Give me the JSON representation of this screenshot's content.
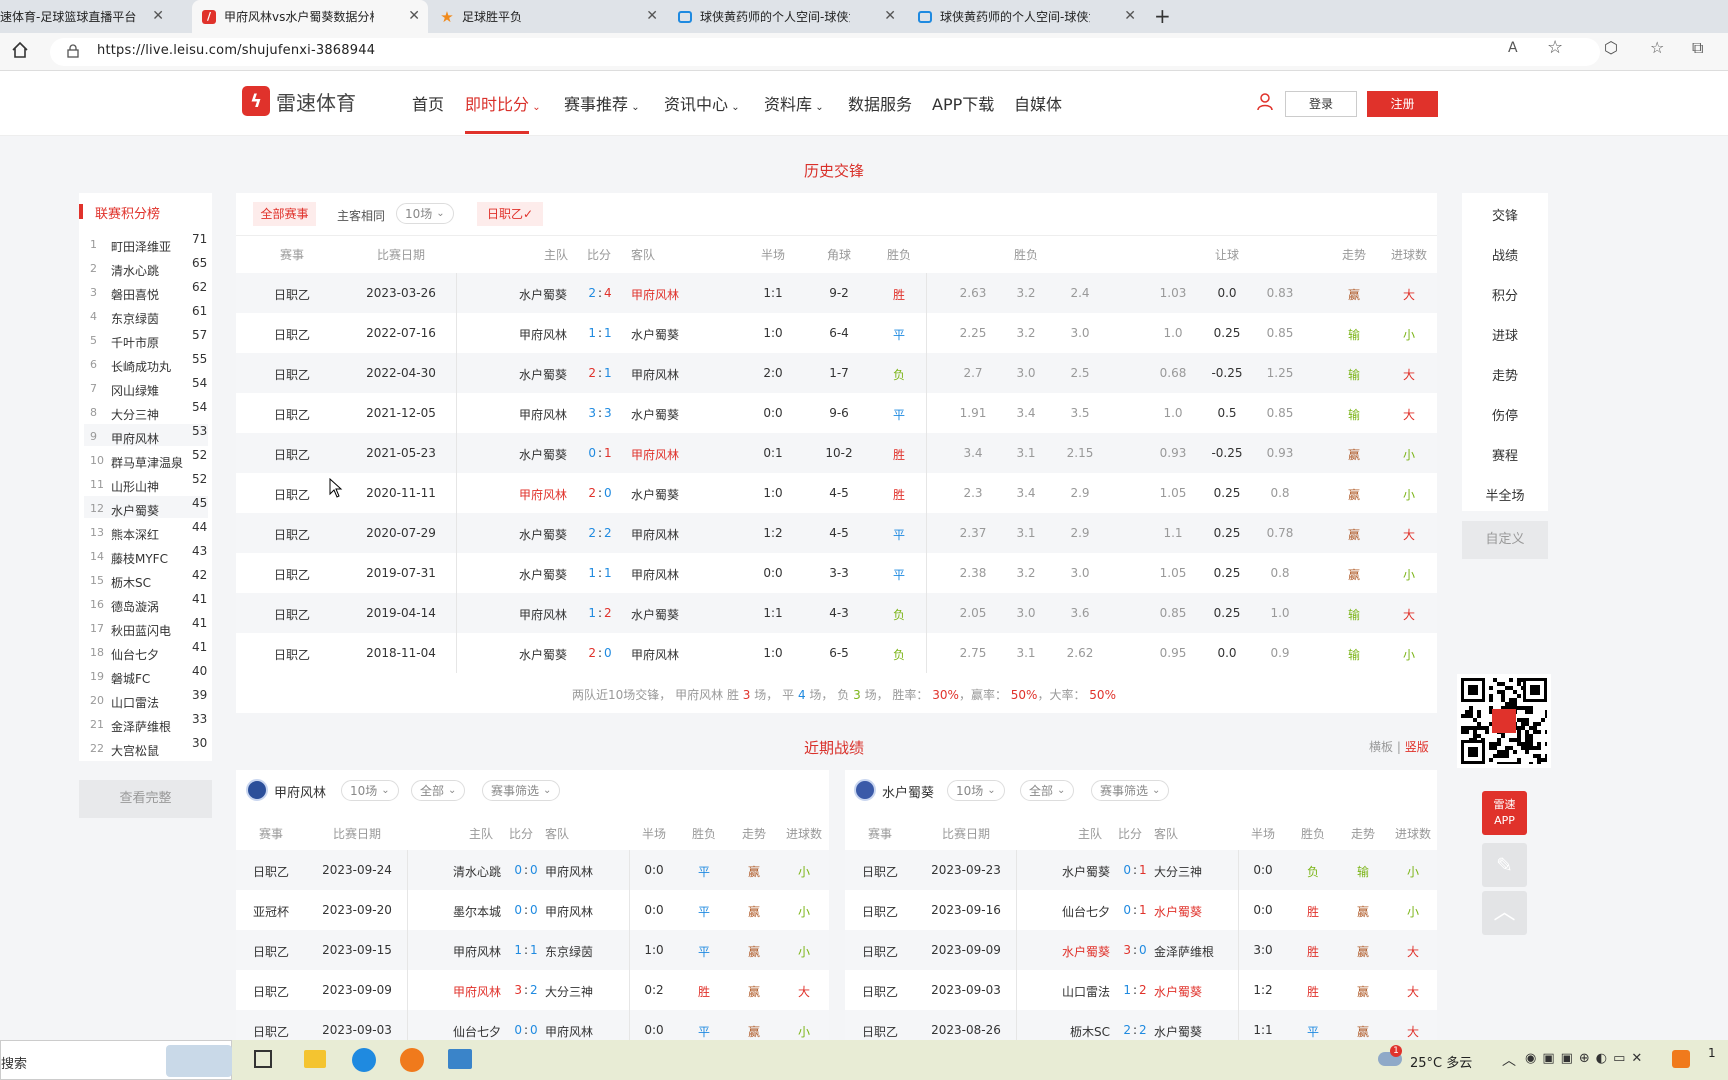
{
  "browser": {
    "tabs": [
      {
        "label": "速体育-足球篮球直播平台",
        "active": false
      },
      {
        "label": "甲府风林vs水户蜀葵数据分析_历",
        "active": true
      },
      {
        "label": "足球胜平负",
        "active": false
      },
      {
        "label": "球侠黄药师的个人空间-球侠黄药",
        "active": false
      },
      {
        "label": "球侠黄药师的个人空间-球侠黄药",
        "active": false
      }
    ],
    "url": "https://live.leisu.com/shujufenxi-3868944"
  },
  "site": {
    "logo": "雷速体育",
    "nav": [
      "首页",
      "即时比分",
      "赛事推荐",
      "资讯中心",
      "资料库",
      "数据服务",
      "APP下载",
      "自媒体"
    ],
    "login": "登录",
    "register": "注册"
  },
  "standings": {
    "title": "联赛积分榜",
    "teams": [
      {
        "rank": "1",
        "name": "町田泽维亚",
        "pts": "71"
      },
      {
        "rank": "2",
        "name": "清水心跳",
        "pts": "65"
      },
      {
        "rank": "3",
        "name": "磐田喜悦",
        "pts": "62"
      },
      {
        "rank": "4",
        "name": "东京绿茵",
        "pts": "61"
      },
      {
        "rank": "5",
        "name": "千叶市原",
        "pts": "57"
      },
      {
        "rank": "6",
        "name": "长崎成功丸",
        "pts": "55"
      },
      {
        "rank": "7",
        "name": "冈山绿雉",
        "pts": "54"
      },
      {
        "rank": "8",
        "name": "大分三神",
        "pts": "54"
      },
      {
        "rank": "9",
        "name": "甲府风林",
        "pts": "53"
      },
      {
        "rank": "10",
        "name": "群马草津温泉",
        "pts": "52"
      },
      {
        "rank": "11",
        "name": "山形山神",
        "pts": "52"
      },
      {
        "rank": "12",
        "name": "水户蜀葵",
        "pts": "45"
      },
      {
        "rank": "13",
        "name": "熊本深红",
        "pts": "44"
      },
      {
        "rank": "14",
        "name": "藤枝MYFC",
        "pts": "43"
      },
      {
        "rank": "15",
        "name": "枥木SC",
        "pts": "42"
      },
      {
        "rank": "16",
        "name": "德岛漩涡",
        "pts": "41"
      },
      {
        "rank": "17",
        "name": "秋田蓝闪电",
        "pts": "41"
      },
      {
        "rank": "18",
        "name": "仙台七夕",
        "pts": "41"
      },
      {
        "rank": "19",
        "name": "磐城FC",
        "pts": "40"
      },
      {
        "rank": "20",
        "name": "山口雷法",
        "pts": "39"
      },
      {
        "rank": "21",
        "name": "金泽萨维根",
        "pts": "33"
      },
      {
        "rank": "22",
        "name": "大宫松鼠",
        "pts": "30"
      }
    ],
    "view_all": "查看完整"
  },
  "h2h": {
    "title": "历史交锋",
    "filters": {
      "all": "全部赛事",
      "same_ha": "主客相同",
      "count": "10场",
      "league": "日职乙✓"
    },
    "headers": [
      "赛事",
      "比赛日期",
      "主队",
      "比分",
      "客队",
      "半场",
      "角球",
      "胜负",
      "胜负",
      "让球",
      "走势",
      "进球数"
    ],
    "rows": [
      {
        "comp": "日职乙",
        "date": "2023-03-26",
        "home": "水户蜀葵",
        "hs": "2",
        "as": "4",
        "away": "甲府风林",
        "ht": "1:1",
        "corner": "9-2",
        "res": "胜",
        "o1": "2.63",
        "o2": "3.2",
        "o3": "2.4",
        "h1": "1.03",
        "h2": "0.0",
        "h3": "0.83",
        "trend": "赢",
        "goals": "大",
        "fufuLeft": false,
        "fufuRight": true
      },
      {
        "comp": "日职乙",
        "date": "2022-07-16",
        "home": "甲府风林",
        "hs": "1",
        "as": "1",
        "away": "水户蜀葵",
        "ht": "1:0",
        "corner": "6-4",
        "res": "平",
        "o1": "2.25",
        "o2": "3.2",
        "o3": "3.0",
        "h1": "1.0",
        "h2": "0.25",
        "h3": "0.85",
        "trend": "输",
        "goals": "小",
        "fufuLeft": false,
        "fufuRight": false
      },
      {
        "comp": "日职乙",
        "date": "2022-04-30",
        "home": "水户蜀葵",
        "hs": "2",
        "as": "1",
        "away": "甲府风林",
        "ht": "2:0",
        "corner": "1-7",
        "res": "负",
        "o1": "2.7",
        "o2": "3.0",
        "o3": "2.5",
        "h1": "0.68",
        "h2": "-0.25",
        "h3": "1.25",
        "trend": "输",
        "goals": "大",
        "fufuLeft": false,
        "fufuRight": false
      },
      {
        "comp": "日职乙",
        "date": "2021-12-05",
        "home": "甲府风林",
        "hs": "3",
        "as": "3",
        "away": "水户蜀葵",
        "ht": "0:0",
        "corner": "9-6",
        "res": "平",
        "o1": "1.91",
        "o2": "3.4",
        "o3": "3.5",
        "h1": "1.0",
        "h2": "0.5",
        "h3": "0.85",
        "trend": "输",
        "goals": "大",
        "fufuLeft": false,
        "fufuRight": false
      },
      {
        "comp": "日职乙",
        "date": "2021-05-23",
        "home": "水户蜀葵",
        "hs": "0",
        "as": "1",
        "away": "甲府风林",
        "ht": "0:1",
        "corner": "10-2",
        "res": "胜",
        "o1": "3.4",
        "o2": "3.1",
        "o3": "2.15",
        "h1": "0.93",
        "h2": "-0.25",
        "h3": "0.93",
        "trend": "赢",
        "goals": "小",
        "fufuLeft": false,
        "fufuRight": true
      },
      {
        "comp": "日职乙",
        "date": "2020-11-11",
        "home": "甲府风林",
        "hs": "2",
        "as": "0",
        "away": "水户蜀葵",
        "ht": "1:0",
        "corner": "4-5",
        "res": "胜",
        "o1": "2.3",
        "o2": "3.4",
        "o3": "2.9",
        "h1": "1.05",
        "h2": "0.25",
        "h3": "0.8",
        "trend": "赢",
        "goals": "小",
        "fufuLeft": true,
        "fufuRight": false
      },
      {
        "comp": "日职乙",
        "date": "2020-07-29",
        "home": "水户蜀葵",
        "hs": "2",
        "as": "2",
        "away": "甲府风林",
        "ht": "1:2",
        "corner": "4-5",
        "res": "平",
        "o1": "2.37",
        "o2": "3.1",
        "o3": "2.9",
        "h1": "1.1",
        "h2": "0.25",
        "h3": "0.78",
        "trend": "赢",
        "goals": "大",
        "fufuLeft": false,
        "fufuRight": false
      },
      {
        "comp": "日职乙",
        "date": "2019-07-31",
        "home": "水户蜀葵",
        "hs": "1",
        "as": "1",
        "away": "甲府风林",
        "ht": "0:0",
        "corner": "3-3",
        "res": "平",
        "o1": "2.38",
        "o2": "3.2",
        "o3": "3.0",
        "h1": "1.05",
        "h2": "0.25",
        "h3": "0.8",
        "trend": "赢",
        "goals": "小",
        "fufuLeft": false,
        "fufuRight": false
      },
      {
        "comp": "日职乙",
        "date": "2019-04-14",
        "home": "甲府风林",
        "hs": "1",
        "as": "2",
        "away": "水户蜀葵",
        "ht": "1:1",
        "corner": "4-3",
        "res": "负",
        "o1": "2.05",
        "o2": "3.0",
        "o3": "3.6",
        "h1": "0.85",
        "h2": "0.25",
        "h3": "1.0",
        "trend": "输",
        "goals": "大",
        "fufuLeft": false,
        "fufuRight": false
      },
      {
        "comp": "日职乙",
        "date": "2018-11-04",
        "home": "水户蜀葵",
        "hs": "2",
        "as": "0",
        "away": "甲府风林",
        "ht": "1:0",
        "corner": "6-5",
        "res": "负",
        "o1": "2.75",
        "o2": "3.1",
        "o3": "2.62",
        "h1": "0.95",
        "h2": "0.0",
        "h3": "0.9",
        "trend": "输",
        "goals": "小",
        "fufuLeft": false,
        "fufuRight": false
      }
    ],
    "summary": {
      "prefix": "两队近10场交锋，",
      "team": "甲府风林",
      "win_label": "胜",
      "win": "3",
      "win_unit": "场，",
      "draw_label": "平",
      "draw": "4",
      "draw_unit": "场，",
      "loss_label": "负",
      "loss": "3",
      "loss_unit": "场，",
      "rate_label": "胜率：",
      "rate": "30%",
      "ying_label": "，赢率：",
      "ying": "50%",
      "da_label": "，大率：",
      "da": "50%"
    }
  },
  "recent": {
    "title": "近期战绩",
    "toggle_h": "横板",
    "sep": "|",
    "toggle_v": "竖版",
    "headers": [
      "赛事",
      "比赛日期",
      "主队",
      "比分",
      "客队",
      "半场",
      "胜负",
      "走势",
      "进球数"
    ],
    "left": {
      "team": "甲府风林",
      "count": "10场",
      "scope": "全部",
      "filter": "赛事筛选",
      "rows": [
        {
          "comp": "日职乙",
          "date": "2023-09-24",
          "home": "清水心跳",
          "hs": "0",
          "as": "0",
          "away": "甲府风林",
          "ht": "0:0",
          "res": "平",
          "trend": "赢",
          "goals": "小",
          "homeRed": false,
          "awayRed": false
        },
        {
          "comp": "亚冠杯",
          "date": "2023-09-20",
          "home": "墨尔本城",
          "hs": "0",
          "as": "0",
          "away": "甲府风林",
          "ht": "0:0",
          "res": "平",
          "trend": "赢",
          "goals": "小",
          "homeRed": false,
          "awayRed": false
        },
        {
          "comp": "日职乙",
          "date": "2023-09-15",
          "home": "甲府风林",
          "hs": "1",
          "as": "1",
          "away": "东京绿茵",
          "ht": "1:0",
          "res": "平",
          "trend": "赢",
          "goals": "小",
          "homeRed": false,
          "awayRed": false
        },
        {
          "comp": "日职乙",
          "date": "2023-09-09",
          "home": "甲府风林",
          "hs": "3",
          "as": "2",
          "away": "大分三神",
          "ht": "0:2",
          "res": "胜",
          "trend": "赢",
          "goals": "大",
          "homeRed": true,
          "awayRed": false
        },
        {
          "comp": "日职乙",
          "date": "2023-09-03",
          "home": "仙台七夕",
          "hs": "0",
          "as": "0",
          "away": "甲府风林",
          "ht": "0:0",
          "res": "平",
          "trend": "赢",
          "goals": "小",
          "homeRed": false,
          "awayRed": false
        }
      ]
    },
    "right": {
      "team": "水户蜀葵",
      "count": "10场",
      "scope": "全部",
      "filter": "赛事筛选",
      "rows": [
        {
          "comp": "日职乙",
          "date": "2023-09-23",
          "home": "水户蜀葵",
          "hs": "0",
          "as": "1",
          "away": "大分三神",
          "ht": "0:0",
          "res": "负",
          "trend": "输",
          "goals": "小",
          "homeRed": false,
          "awayRed": false
        },
        {
          "comp": "日职乙",
          "date": "2023-09-16",
          "home": "仙台七夕",
          "hs": "0",
          "as": "1",
          "away": "水户蜀葵",
          "ht": "0:0",
          "res": "胜",
          "trend": "赢",
          "goals": "小",
          "homeRed": false,
          "awayRed": true
        },
        {
          "comp": "日职乙",
          "date": "2023-09-09",
          "home": "水户蜀葵",
          "hs": "3",
          "as": "0",
          "away": "金泽萨维根",
          "ht": "3:0",
          "res": "胜",
          "trend": "赢",
          "goals": "大",
          "homeRed": true,
          "awayRed": false
        },
        {
          "comp": "日职乙",
          "date": "2023-09-03",
          "home": "山口雷法",
          "hs": "1",
          "as": "2",
          "away": "水户蜀葵",
          "ht": "1:2",
          "res": "胜",
          "trend": "赢",
          "goals": "大",
          "homeRed": false,
          "awayRed": true
        },
        {
          "comp": "日职乙",
          "date": "2023-08-26",
          "home": "枥木SC",
          "hs": "2",
          "as": "2",
          "away": "水户蜀葵",
          "ht": "1:1",
          "res": "平",
          "trend": "赢",
          "goals": "大",
          "homeRed": false,
          "awayRed": false
        }
      ]
    }
  },
  "sidenav": {
    "items": [
      "交锋",
      "战绩",
      "积分",
      "进球",
      "走势",
      "伤停",
      "赛程",
      "半全场"
    ],
    "custom": "自定义",
    "app_l1": "雷速",
    "app_l2": "APP"
  },
  "taskbar": {
    "search": "搜索",
    "weather": "25°C 多云",
    "notify": "1",
    "clock": "1"
  },
  "colors": {
    "accent": "#e0322b",
    "draw": "#1f8ae0",
    "loss": "#7cb518",
    "win_trend": "#b05c2a"
  }
}
